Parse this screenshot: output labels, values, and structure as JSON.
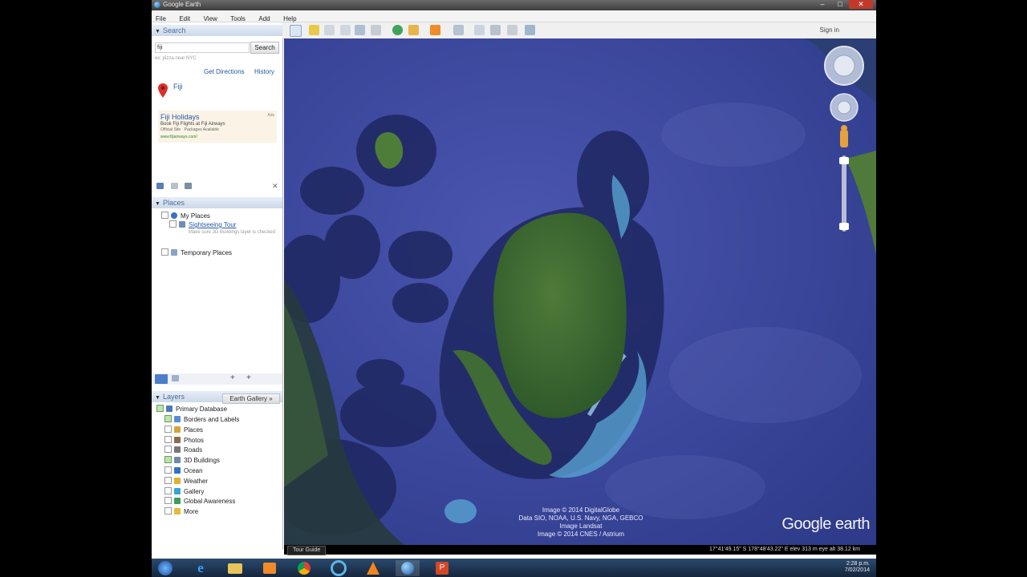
{
  "window": {
    "title": "Google Earth"
  },
  "menu": [
    "File",
    "Edit",
    "View",
    "Tools",
    "Add",
    "Help"
  ],
  "search_panel": {
    "header": "Search",
    "query": "fiji",
    "button": "Search",
    "hint": "ex: pizza near NYC",
    "directions_link": "Get Directions",
    "history_link": "History",
    "result": "Fiji",
    "ad": {
      "title": "Fiji Holidays",
      "line1": "Book Fiji Flights at Fiji Airways",
      "line2": "Official Site · Packages Available",
      "url": "www.fijiairways.com/",
      "tag": "Ads"
    }
  },
  "places_panel": {
    "header": "Places",
    "my_places": "My Places",
    "sightseeing": "Sightseeing Tour",
    "sightseeing_note": "Make sure 3D Buildings layer is checked",
    "temporary": "Temporary Places"
  },
  "layers_panel": {
    "header": "Layers",
    "gallery_button": "Earth Gallery »",
    "root": "Primary Database",
    "items": [
      {
        "label": "Borders and Labels",
        "checked": true,
        "icon": "flag-icon",
        "color": "#5b8bd6"
      },
      {
        "label": "Places",
        "checked": false,
        "icon": "pin-layer-icon",
        "color": "#d9a13b"
      },
      {
        "label": "Photos",
        "checked": false,
        "icon": "photo-icon",
        "color": "#8a6c4f"
      },
      {
        "label": "Roads",
        "checked": false,
        "icon": "road-icon",
        "color": "#777777"
      },
      {
        "label": "3D Buildings",
        "checked": true,
        "icon": "building-icon",
        "color": "#6d8aa8"
      },
      {
        "label": "Ocean",
        "checked": false,
        "icon": "ocean-icon",
        "color": "#2f73c9"
      },
      {
        "label": "Weather",
        "checked": false,
        "icon": "weather-icon",
        "color": "#e0b130"
      },
      {
        "label": "Gallery",
        "checked": false,
        "icon": "gallery-icon",
        "color": "#3aa1d8"
      },
      {
        "label": "Global Awareness",
        "checked": false,
        "icon": "globe-icon",
        "color": "#3c9d5e"
      },
      {
        "label": "More",
        "checked": false,
        "icon": "more-icon",
        "color": "#e6b93a"
      }
    ]
  },
  "toolbar": {
    "signin": "Sign in"
  },
  "map": {
    "attribution": [
      "Image © 2014 DigitalGlobe",
      "Data SIO, NOAA, U.S. Navy, NGA, GEBCO",
      "Image Landsat",
      "Image © 2014 CNES / Astrium"
    ],
    "logo": "Google earth"
  },
  "status": {
    "tour_guide": "Tour Guide",
    "coords": "17°41'49.15\" S  178°48'43.22\" E  elev  313 m     eye alt  38.12 km"
  },
  "taskbar": {
    "time": "2:28 p.m.",
    "date": "7/02/2014"
  }
}
